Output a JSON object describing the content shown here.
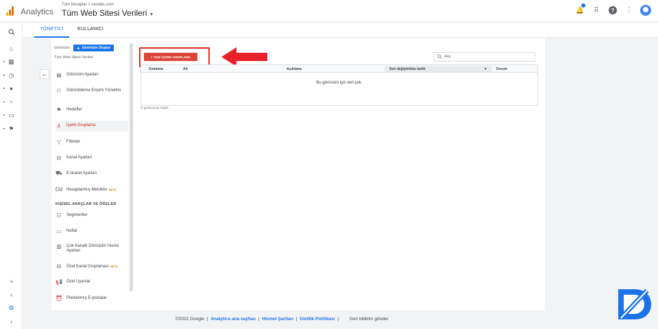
{
  "header": {
    "app_title": "Analytics",
    "breadcrumb": "Tüm hesaplar > seoabc.com",
    "view_title": "Tüm Web Sitesi Verileri"
  },
  "tabs": [
    {
      "label": "YÖNETİCİ"
    },
    {
      "label": "KULLANICI"
    }
  ],
  "view_column": {
    "view_label": "Görünüm",
    "create_view_button": "Görünüm Oluştur",
    "selected_view": "Tüm Web Sitesi Verileri"
  },
  "menu": {
    "items": [
      {
        "label": "Görünüm Ayarları",
        "icon": "document-icon"
      },
      {
        "label": "Görüntüleme Erişimi Yönetimi",
        "icon": "people-icon"
      },
      {
        "label": "Hedefler",
        "icon": "flag-icon"
      },
      {
        "label": "İçerik Gruplama",
        "icon": "content-grouping-icon"
      },
      {
        "label": "Filtreler",
        "icon": "filter-icon"
      },
      {
        "label": "Kanal Ayarları",
        "icon": "channel-icon"
      },
      {
        "label": "E-ticaret Ayarları",
        "icon": "cart-icon"
      },
      {
        "label": "Hesaplanmış Metrikler",
        "icon": "calculator-icon",
        "badge": "BETA"
      }
    ],
    "section_title": "KİŞİSEL ARAÇLAR VE ÖĞELER",
    "personal_items": [
      {
        "label": "Segmentler",
        "icon": "segment-icon"
      },
      {
        "label": "Notlar",
        "icon": "note-icon"
      },
      {
        "label": "Çok Kanallı Dönüşüm Hunisi Ayarları",
        "icon": "bar-chart-icon"
      },
      {
        "label": "Özel Kanal Gruplaması",
        "icon": "channel-icon",
        "badge": "BETA"
      },
      {
        "label": "Özel Uyarılar",
        "icon": "megaphone-icon"
      },
      {
        "label": "Planlanmış E-postalar",
        "icon": "clock-icon"
      }
    ]
  },
  "content": {
    "new_group_button": "+ YENİ İÇERİK GRUPLAMA",
    "search_placeholder": "Ara",
    "columns": [
      "Sıralama",
      "Ad",
      "Açıklama",
      "Son değiştirilme tarihi",
      "Durum"
    ],
    "empty_message": "Bu görünüm için veri yok.",
    "row_count": "0 grubunuz kaldı"
  },
  "footer": {
    "copyright": "©2022 Google",
    "links": [
      "Analytics ana sayfası",
      "Hizmet Şartları",
      "Gizlilik Politikası"
    ],
    "feedback": "Geri bildirim gönder"
  },
  "colors": {
    "accent": "#1a73e8",
    "danger": "#db4437",
    "highlight": "#d93025"
  }
}
